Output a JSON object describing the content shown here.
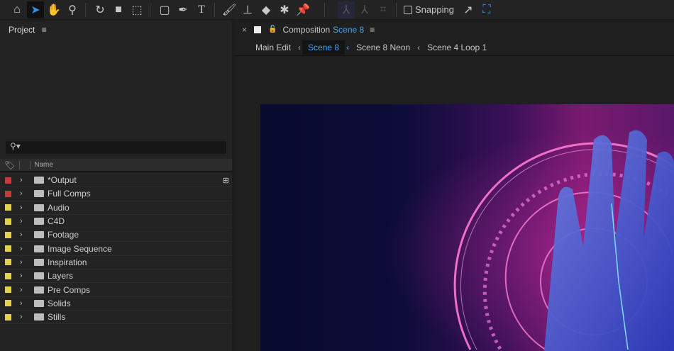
{
  "toolbar": {
    "tools": [
      "home-icon",
      "selection-icon",
      "hand-icon",
      "zoom-icon",
      "rotate-icon",
      "camera-icon",
      "pan-behind-icon",
      "rectangle-icon",
      "pen-icon",
      "type-icon",
      "brush-icon",
      "clone-stamp-icon",
      "eraser-icon",
      "roto-brush-icon",
      "puppet-pin-icon"
    ],
    "snapping_label": "Snapping"
  },
  "project": {
    "title": "Project",
    "search_placeholder": "",
    "column_name": "Name",
    "items": [
      {
        "label": "*Output",
        "color": "#c83a3a"
      },
      {
        "label": "Full Comps",
        "color": "#c83a3a"
      },
      {
        "label": "Audio",
        "color": "#e2d24a"
      },
      {
        "label": "C4D",
        "color": "#e2d24a"
      },
      {
        "label": "Footage",
        "color": "#e2d24a"
      },
      {
        "label": "Image Sequence",
        "color": "#e2d24a"
      },
      {
        "label": "Inspiration",
        "color": "#e2d24a"
      },
      {
        "label": "Layers",
        "color": "#e2d24a"
      },
      {
        "label": "Pre Comps",
        "color": "#e2d24a"
      },
      {
        "label": "Solids",
        "color": "#e2d24a"
      },
      {
        "label": "Stills",
        "color": "#e2d24a"
      }
    ]
  },
  "composition": {
    "prefix": "Composition",
    "name": "Scene 8",
    "breadcrumbs": [
      "Main Edit",
      "Scene 8",
      "Scene 8 Neon",
      "Scene 4 Loop 1"
    ],
    "active_crumb": 1
  }
}
